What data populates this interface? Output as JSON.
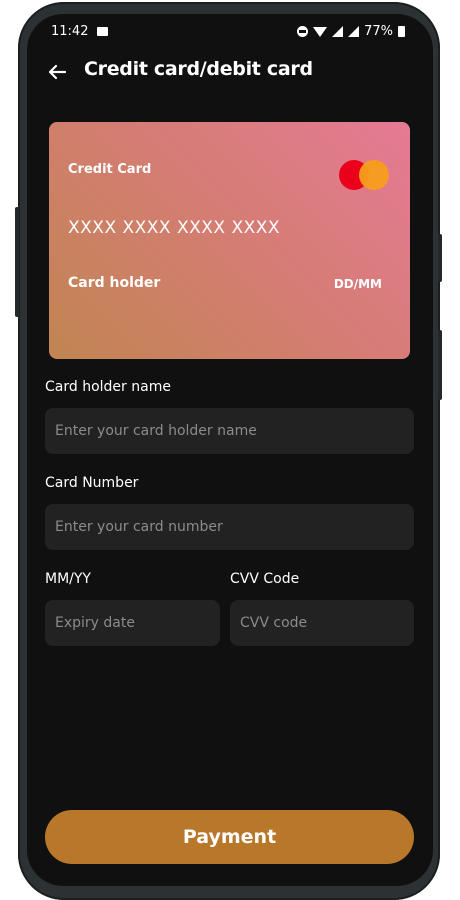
{
  "status_bar": {
    "time": "11:42",
    "battery": "77%"
  },
  "header": {
    "title": "Credit card/debit card"
  },
  "card": {
    "type_label": "Credit Card",
    "number": "XXXX XXXX XXXX XXXX",
    "holder_label": "Card holder",
    "expiry_label": "DD/MM",
    "brand_icon": "mastercard-logo"
  },
  "form": {
    "holder_name": {
      "label": "Card holder name",
      "placeholder": "Enter your card holder name",
      "value": ""
    },
    "card_number": {
      "label": "Card Number",
      "placeholder": "Enter your card number",
      "value": ""
    },
    "expiry": {
      "label": "MM/YY",
      "placeholder": "Expiry date",
      "value": ""
    },
    "cvv": {
      "label": "CVV Code",
      "placeholder": "CVV code",
      "value": ""
    }
  },
  "payment_button": {
    "label": "Payment"
  },
  "colors": {
    "background": "#0f100f",
    "field_bg": "#222222",
    "button_bg": "#b9772a",
    "card_gradient_start": "#e57a95",
    "card_gradient_end": "#c18552"
  }
}
